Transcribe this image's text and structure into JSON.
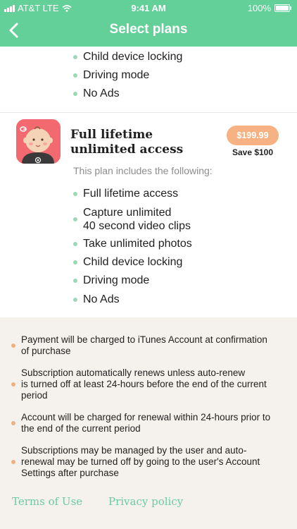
{
  "status_bar": {
    "carrier": "AT&T LTE",
    "time": "9:41 AM",
    "battery": "100%"
  },
  "nav": {
    "title": "Select plans"
  },
  "previous_plan_features": [
    "Child device locking",
    "Driving mode",
    "No Ads"
  ],
  "plan": {
    "title_line1": "Full lifetime",
    "title_line2": "unlimited access",
    "price": "$199.99",
    "save": "Save $100",
    "includes_label": "This plan includes the following:",
    "features": [
      "Full lifetime access",
      "Capture unlimited",
      "40 second video clips",
      "Take unlimited photos",
      "Child device locking",
      "Driving mode",
      "No Ads"
    ]
  },
  "legal": [
    {
      "line1": "Payment will be charged to iTunes Account at confirmation",
      "line2": "of purchase",
      "line3": ""
    },
    {
      "line1": "Subscription automatically renews unless auto-renew",
      "line2": "is turned off at least 24-hours before the end of the current",
      "line3": "period"
    },
    {
      "line1": "Account will be charged for renewal within 24-hours prior to",
      "line2": "the end of the current period",
      "line3": ""
    },
    {
      "line1": "Subscriptions may be managed by the user and auto-",
      "line2": "renewal may be turned off by going to the user's Account",
      "line3": "Settings after purchase"
    }
  ],
  "footer": {
    "terms": "Terms of Use",
    "privacy": "Privacy policy"
  },
  "colors": {
    "header": "#63cf99",
    "price_button": "#f6b283",
    "link": "#6dcaa5",
    "bullet_feature": "#9bd9b7",
    "bullet_legal": "#f0b17f"
  }
}
